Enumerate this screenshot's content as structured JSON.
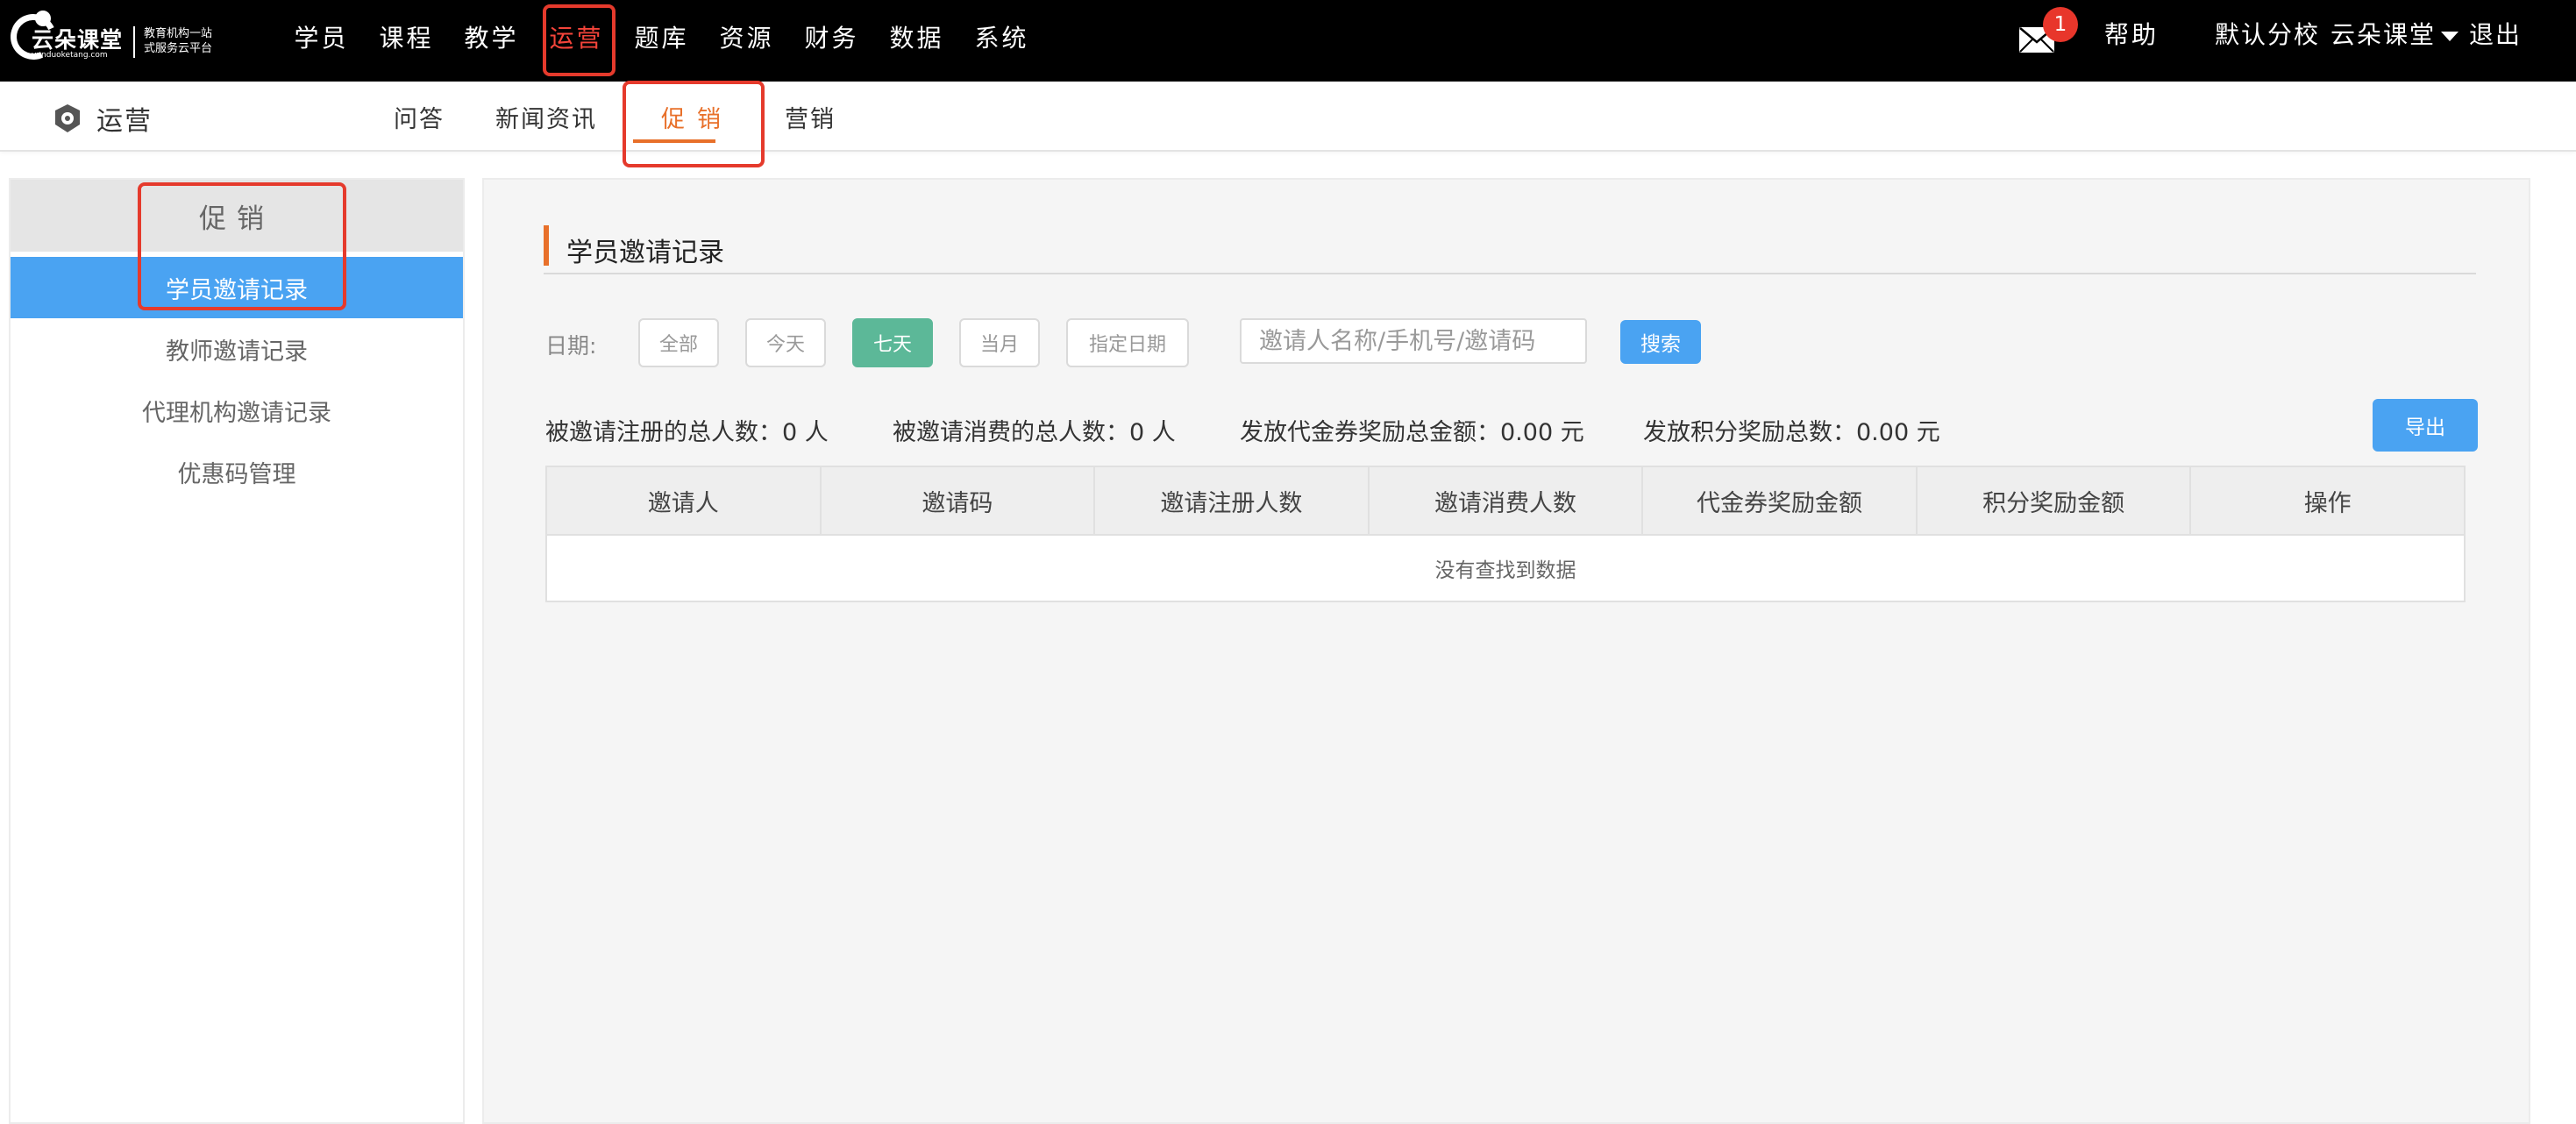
{
  "brand": {
    "name": "云朵课堂",
    "domain": "yunduoketang.com",
    "slogan": "教育机构一站式服务云平台"
  },
  "topnav": {
    "items": [
      {
        "label": "学员"
      },
      {
        "label": "课程"
      },
      {
        "label": "教学"
      },
      {
        "label": "运营",
        "active": true
      },
      {
        "label": "题库"
      },
      {
        "label": "资源"
      },
      {
        "label": "财务"
      },
      {
        "label": "数据"
      },
      {
        "label": "系统"
      }
    ],
    "mail_count": "1",
    "help": "帮助",
    "school": "默认分校",
    "user": "云朵课堂",
    "logout": "退出"
  },
  "subbar": {
    "module": "运营",
    "tabs": [
      {
        "label": "问答"
      },
      {
        "label": "新闻资讯"
      },
      {
        "label": "促销",
        "active": true
      },
      {
        "label": "营销"
      }
    ]
  },
  "sidebar": {
    "title": "促销",
    "items": [
      {
        "label": "学员邀请记录",
        "active": true
      },
      {
        "label": "教师邀请记录"
      },
      {
        "label": "代理机构邀请记录"
      },
      {
        "label": "优惠码管理"
      }
    ]
  },
  "main": {
    "section_title": "学员邀请记录",
    "date_label": "日期:",
    "date_filters": [
      {
        "label": "全部"
      },
      {
        "label": "今天"
      },
      {
        "label": "七天",
        "active": true
      },
      {
        "label": "当月"
      },
      {
        "label": "指定日期"
      }
    ],
    "search_placeholder": "邀请人名称/手机号/邀请码",
    "search_button": "搜索",
    "stats": [
      "被邀请注册的总人数：0 人",
      "被邀请消费的总人数：0 人",
      "发放代金券奖励总金额：0.00 元",
      "发放积分奖励总数：0.00 元"
    ],
    "export_button": "导出",
    "table": {
      "headers": [
        "邀请人",
        "邀请码",
        "邀请注册人数",
        "邀请消费人数",
        "代金券奖励金额",
        "积分奖励金额",
        "操作"
      ],
      "empty_text": "没有查找到数据"
    }
  },
  "colors": {
    "topbar": "#000000",
    "accent_orange": "#e8702a",
    "primary_blue": "#4aa3f2",
    "active_green": "#5cb898",
    "highlight_red": "#e53a2c"
  }
}
